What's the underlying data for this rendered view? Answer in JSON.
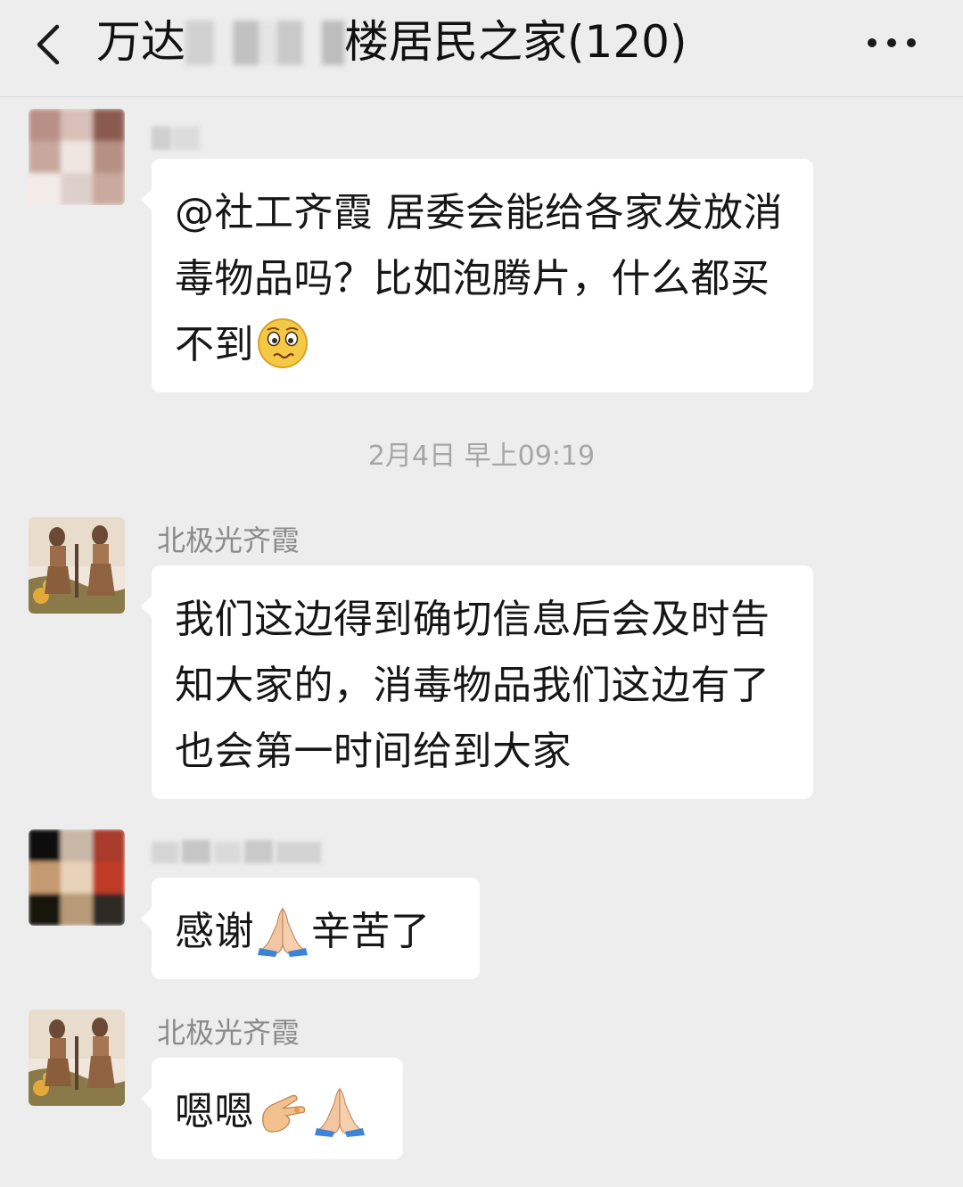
{
  "header": {
    "title_prefix": "万达",
    "title_suffix": "楼居民之家(120)"
  },
  "date_divider": "2月4日 早上09:19",
  "messages": [
    {
      "text_parts": [
        "@社工齐霞  居委会能给各家发放消毒物品吗？比如泡腾片，什么都买不到",
        ""
      ],
      "emojis": [
        "worried-face-emoji"
      ]
    },
    {
      "sender": "北极光齐霞",
      "text": "我们这边得到确切信息后会及时告知大家的，消毒物品我们这边有了也会第一时间给到大家"
    },
    {
      "text_before": "感谢",
      "text_after": "辛苦了",
      "emojis": [
        "folded-hands-emoji"
      ]
    },
    {
      "sender": "北极光齐霞",
      "text": "嗯嗯",
      "emojis": [
        "pinching-hand-emoji",
        "folded-hands-emoji"
      ]
    }
  ],
  "colors": {
    "background": "#ededed",
    "bubble": "#ffffff",
    "text": "#161616",
    "sender_text": "#8b8b8b",
    "timestamp_text": "#a6a6a6"
  }
}
